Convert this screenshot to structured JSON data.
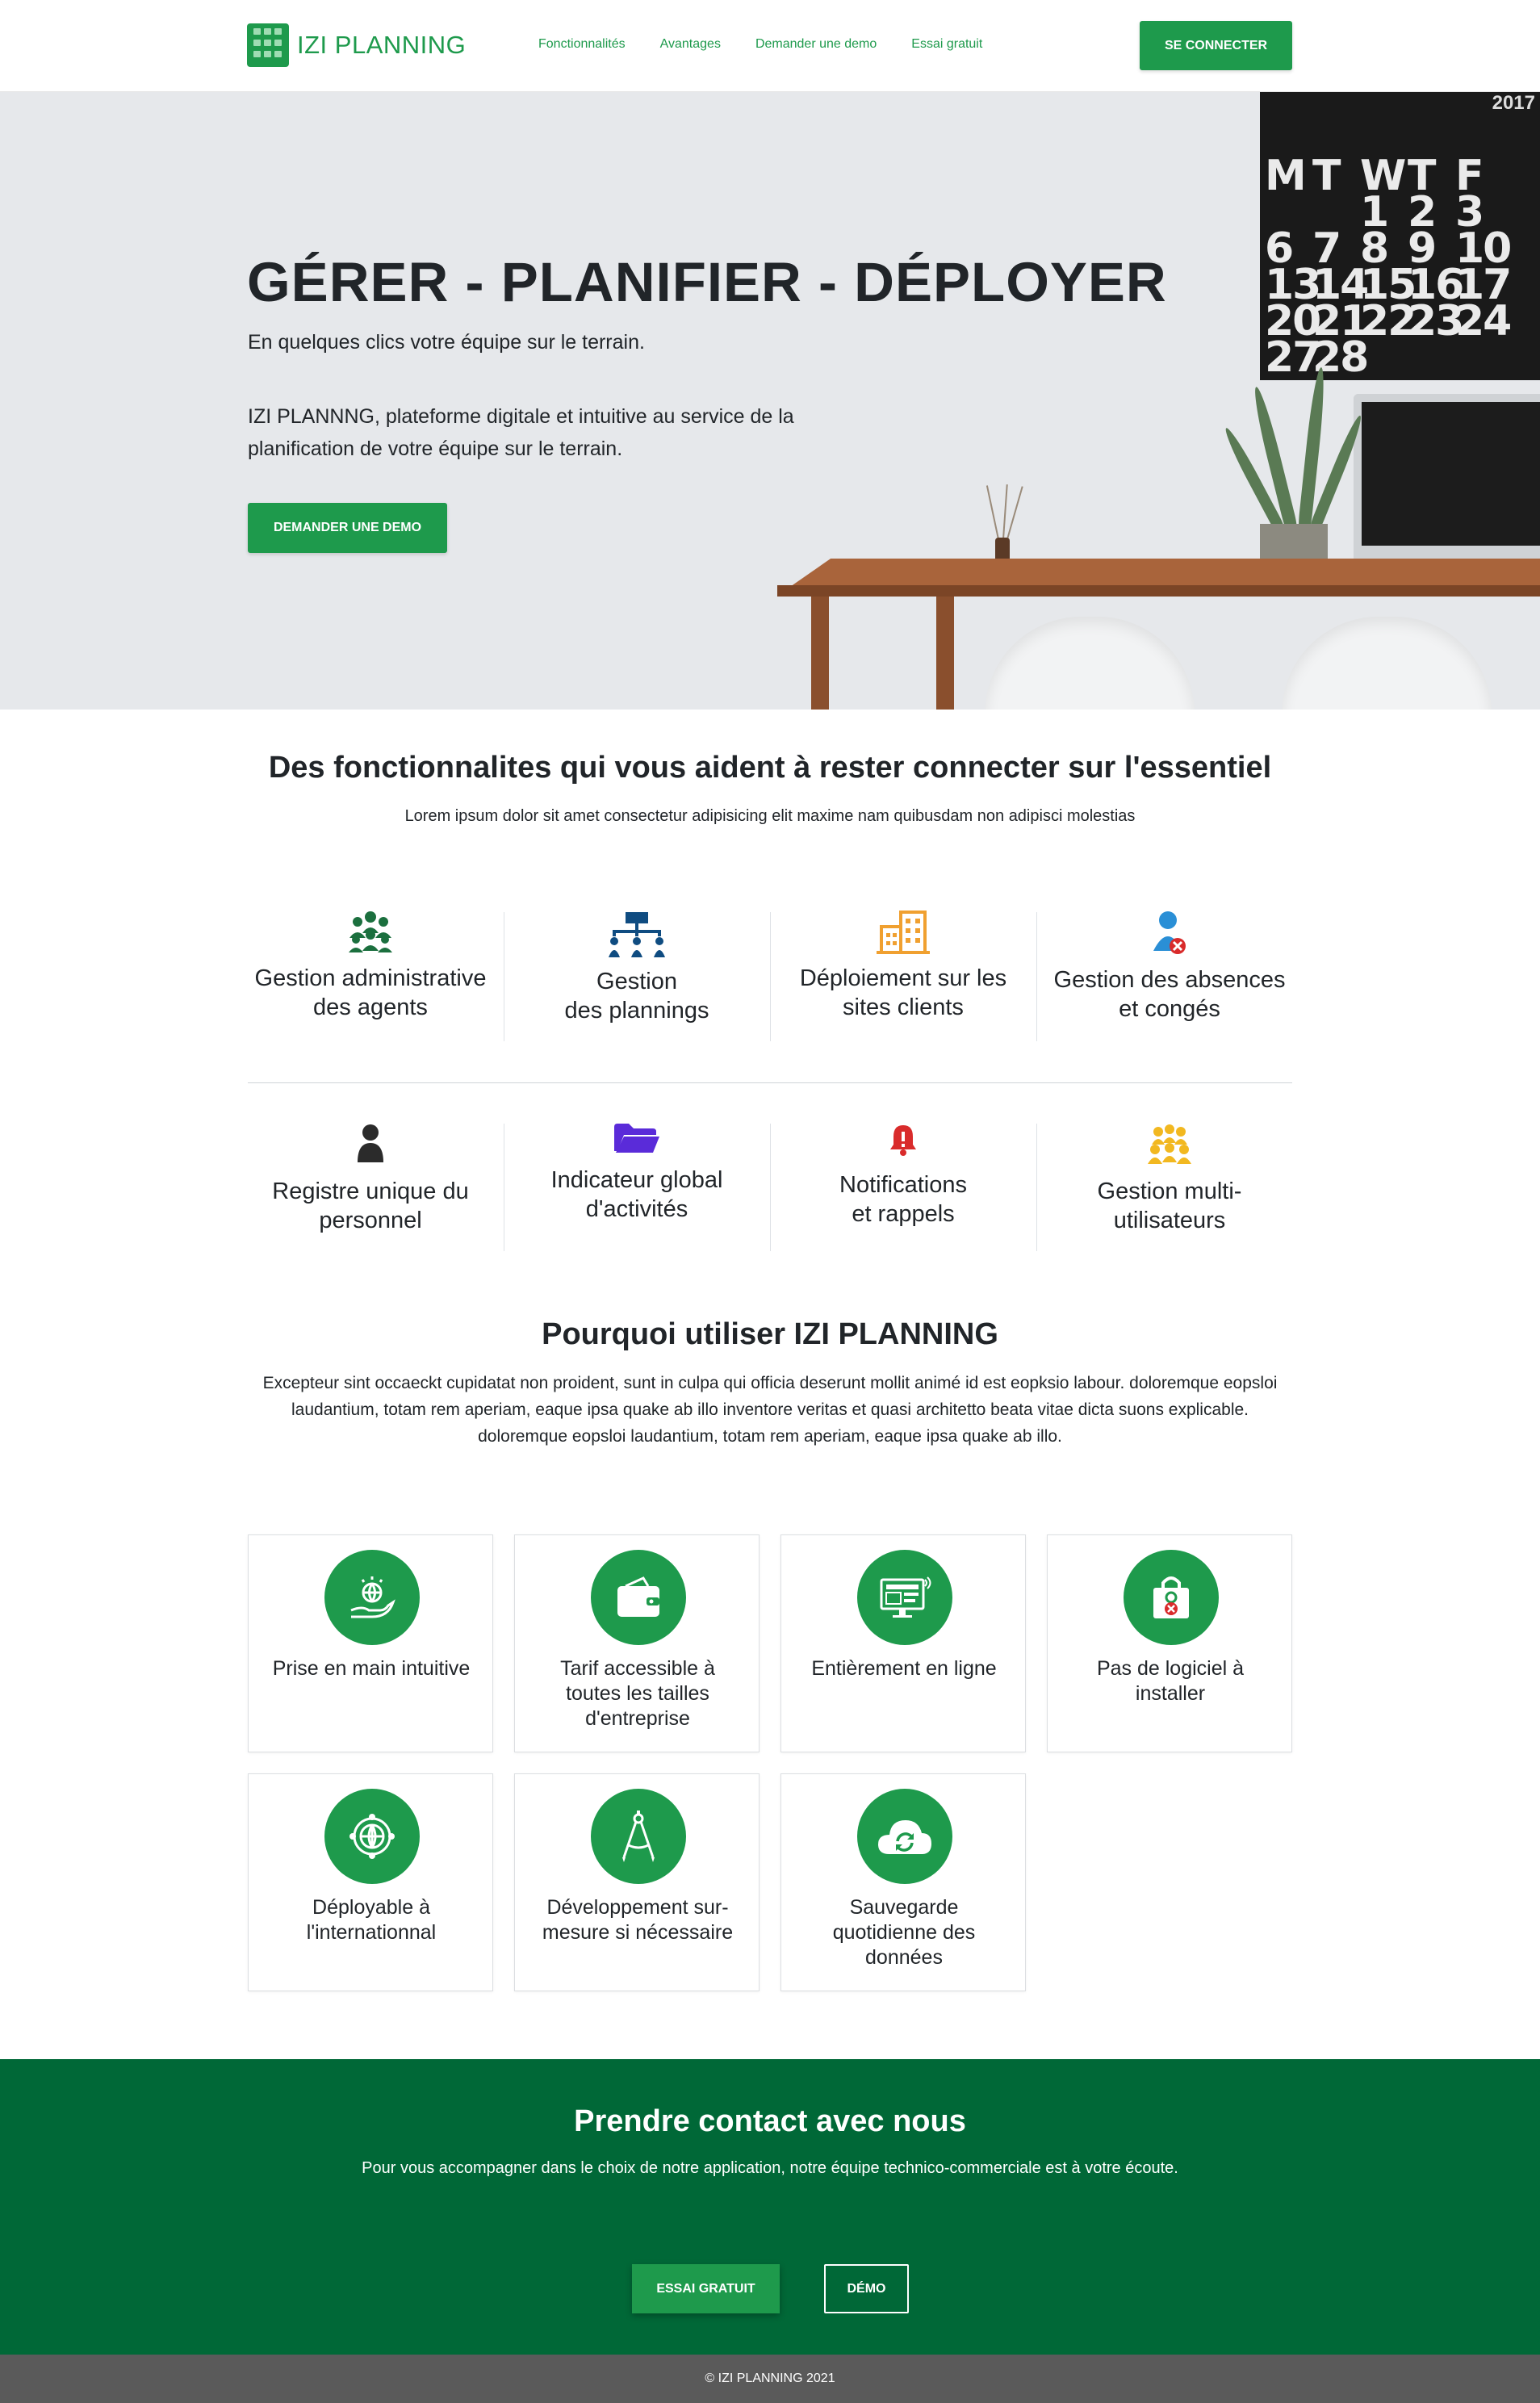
{
  "navbar": {
    "brand": "IZI PLANNING",
    "links": [
      "Fonctionnalités",
      "Avantages",
      "Demander une demo",
      "Essai gratuit"
    ],
    "login_label": "SE CONNECTER",
    "accent": "#1e9a4c"
  },
  "hero": {
    "title": "GÉRER - PLANIFIER - DÉPLOYER",
    "subtitle": "En quelques clics votre équipe sur le terrain.",
    "description": "IZI PLANNNG, plateforme digitale et intuitive au service de la planification de votre équipe sur le terrain.",
    "cta_label": "DEMANDER UNE DEMO",
    "calendar_year": "2017",
    "calendar_header": [
      "M",
      "T",
      "W",
      "T",
      "F"
    ],
    "calendar_rows": [
      [
        "",
        "",
        "1",
        "2",
        "3"
      ],
      [
        "6",
        "7",
        "8",
        "9",
        "10"
      ],
      [
        "13",
        "14",
        "15",
        "16",
        "17"
      ],
      [
        "20",
        "21",
        "22",
        "23",
        "24"
      ],
      [
        "27",
        "28",
        "",
        "",
        ""
      ]
    ]
  },
  "features": {
    "title": "Des fonctionnalites qui vous aident à rester connecter sur l'essentiel",
    "subtitle": "Lorem ipsum dolor sit amet consectetur adipisicing elit maxime nam quibusdam non adipisci molestias",
    "items": [
      {
        "label": "Gestion administrative\ndes agents",
        "icon": "people-group-icon",
        "color": "#1b6f3e"
      },
      {
        "label": "Gestion\ndes plannings",
        "icon": "org-chart-icon",
        "color": "#0f4c81"
      },
      {
        "label": "Déploiement sur les\nsites clients",
        "icon": "buildings-icon",
        "color": "#f0a030"
      },
      {
        "label": "Gestion des absences\net congés",
        "icon": "user-absent-icon",
        "color": "#2a8fd6"
      },
      {
        "label": "Registre unique du\npersonnel",
        "icon": "person-icon",
        "color": "#2b2b2b"
      },
      {
        "label": "Indicateur global\nd'activités",
        "icon": "folder-icon",
        "color": "#5a2bd9"
      },
      {
        "label": "Notifications\net rappels",
        "icon": "bell-icon",
        "color": "#d92b2b"
      },
      {
        "label": "Gestion multi-\nutilisateurs",
        "icon": "users-group-icon",
        "color": "#f2b820"
      }
    ]
  },
  "why": {
    "title": "Pourquoi utiliser IZI PLANNING",
    "text": "Excepteur sint occaeckt cupidatat non proident, sunt in culpa qui officia deserunt mollit animé id est eopksio labour. doloremque eopsloi laudantium, totam rem aperiam, eaque ipsa quake ab illo inventore veritas et quasi architetto beata vitae dicta suons explicable. doloremque eopsloi laudantium, totam rem aperiam, eaque ipsa quake ab illo.",
    "cards": [
      {
        "label": "Prise en main intuitive",
        "icon": "hand-globe-icon"
      },
      {
        "label": "Tarif accessible à\ntoutes les tailles\nd'entreprise",
        "icon": "wallet-icon"
      },
      {
        "label": "Entièrement en ligne",
        "icon": "online-monitor-icon"
      },
      {
        "label": "Pas de logiciel à\ninstaller",
        "icon": "no-install-icon"
      },
      {
        "label": "Déployable à\nl'internationnal",
        "icon": "globe-icon"
      },
      {
        "label": "Développement sur-\nmesure si nécessaire",
        "icon": "compass-icon"
      },
      {
        "label": "Sauvegarde\nquotidienne des\ndonnées",
        "icon": "cloud-sync-icon"
      }
    ]
  },
  "contact": {
    "title": "Prendre contact avec nous",
    "text": "Pour vous accompagner dans le choix de notre application, notre équipe technico-commerciale est à votre écoute.",
    "trial_label": "ESSAI GRATUIT",
    "demo_label": "DÉMO",
    "background": "#006837"
  },
  "footer": {
    "copyright": "© IZI PLANNING 2021"
  }
}
